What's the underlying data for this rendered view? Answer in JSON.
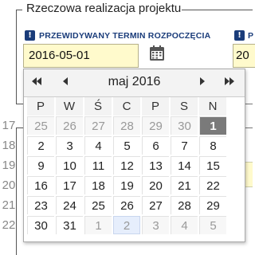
{
  "fieldset": {
    "legend": "Rzeczowa realizacja projektu"
  },
  "fields": {
    "start_label": "PRZEWIDYWANY TERMIN ROZPOCZĘCIA",
    "start_value": "2016-05-01",
    "second_label_fragment": "P",
    "second_value_fragment": "20",
    "info_icon": "!"
  },
  "icons": {
    "calendar": "calendar-icon",
    "info": "info-icon"
  },
  "datepicker": {
    "prev_year": "◀◀",
    "prev_month": "◀",
    "month_title": "maj 2016",
    "next_month": "▶",
    "next_year": "▶▶",
    "weekdays": [
      "P",
      "W",
      "Ś",
      "C",
      "P",
      "S",
      "N"
    ],
    "weeks": [
      {
        "num": "17",
        "days": [
          "25",
          "26",
          "27",
          "28",
          "29",
          "30",
          "1"
        ]
      },
      {
        "num": "18",
        "days": [
          "2",
          "3",
          "4",
          "5",
          "6",
          "7",
          "8"
        ]
      },
      {
        "num": "19",
        "days": [
          "9",
          "10",
          "11",
          "12",
          "13",
          "14",
          "15"
        ]
      },
      {
        "num": "20",
        "days": [
          "16",
          "17",
          "18",
          "19",
          "20",
          "21",
          "22"
        ]
      },
      {
        "num": "21",
        "days": [
          "23",
          "24",
          "25",
          "26",
          "27",
          "28",
          "29"
        ]
      },
      {
        "num": "22",
        "days": [
          "30",
          "31",
          "1",
          "2",
          "3",
          "4",
          "5"
        ]
      }
    ],
    "selected": "1",
    "today": "2"
  },
  "colors": {
    "accent": "#1a3c7a",
    "input_bg": "#fffacc",
    "selected_bg": "#7a7a7a",
    "today_bg": "#e6eefc"
  }
}
